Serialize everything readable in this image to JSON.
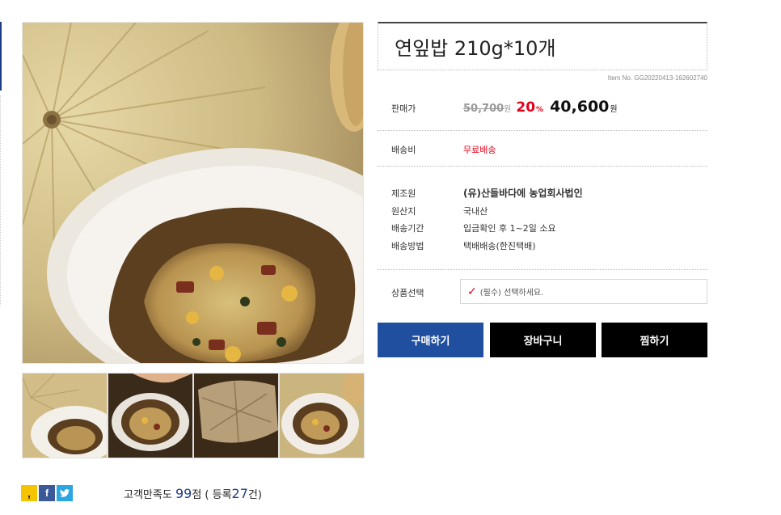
{
  "product": {
    "title": "연잎밥 210g*10개",
    "item_no": "Item No. GG20220413-162602740"
  },
  "price": {
    "label": "판매가",
    "original": "50,700",
    "original_unit": "원",
    "discount": "20",
    "discount_unit": "%",
    "sale": "40,600",
    "sale_unit": "원"
  },
  "shipping": {
    "label": "배송비",
    "value": "무료배송"
  },
  "details": [
    {
      "label": "제조원",
      "value": "(유)산들바다에 농업회사법인"
    },
    {
      "label": "원산지",
      "value": "국내산"
    },
    {
      "label": "배송기간",
      "value": "입금확인 후 1~2일 소요"
    },
    {
      "label": "배송방법",
      "value": "택배배송(한진택배)"
    }
  ],
  "option": {
    "label": "상품선택",
    "placeholder": "(필수) 선택하세요."
  },
  "buttons": {
    "buy": "구매하기",
    "cart": "장바구니",
    "wish": "찜하기"
  },
  "social": {
    "kakao": "kakao-icon",
    "facebook": "facebook-icon",
    "twitter": "twitter-icon"
  },
  "rating": {
    "prefix": "고객만족도",
    "score": "99",
    "score_unit": "점",
    "open": "( 등록",
    "count": "27",
    "count_unit": "건)"
  },
  "colors": {
    "accent": "#1f4f9e",
    "sale_red": "#e2001a",
    "dark": "#000000"
  }
}
